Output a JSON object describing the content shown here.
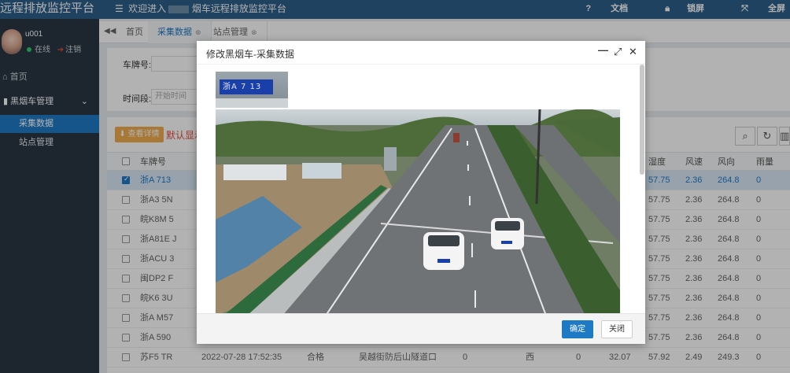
{
  "brand": "远程排放监控平台",
  "topbar": {
    "welcome": "欢迎进入",
    "welcome_rest": "烟车远程排放监控平台",
    "doc": "文档",
    "lock": "锁屏",
    "fullscreen": "全屏"
  },
  "user": {
    "name": "u001",
    "online": "在线",
    "logout": "注销"
  },
  "sidebar": {
    "home": "首页",
    "group": "黑烟车管理",
    "items": [
      {
        "label": "采集数据",
        "active": true
      },
      {
        "label": "站点管理",
        "active": false
      }
    ]
  },
  "tabs": [
    {
      "label": "首页",
      "active": false,
      "closable": false
    },
    {
      "label": "采集数据",
      "active": true,
      "closable": true
    },
    {
      "label": "站点管理",
      "active": false,
      "closable": true
    }
  ],
  "search": {
    "plate_label": "车牌号:",
    "time_label": "时间段:",
    "time_placeholder": "开始时间"
  },
  "toolbar": {
    "detail_button": "查看详情",
    "default_show": "默认显示"
  },
  "table": {
    "left_columns": [
      "车牌号"
    ],
    "right_columns": [
      "湿度",
      "风速",
      "风向",
      "雨量"
    ],
    "rows": [
      {
        "plate": "浙A 713",
        "humidity": "57.75",
        "wind_speed": "2.36",
        "wind_dir": "264.8",
        "rain": "0",
        "selected": true
      },
      {
        "plate": "浙A3 5N",
        "humidity": "57.75",
        "wind_speed": "2.36",
        "wind_dir": "264.8",
        "rain": "0",
        "selected": false
      },
      {
        "plate": "皖K8M 5",
        "humidity": "57.75",
        "wind_speed": "2.36",
        "wind_dir": "264.8",
        "rain": "0",
        "selected": false
      },
      {
        "plate": "浙A81E J",
        "humidity": "57.75",
        "wind_speed": "2.36",
        "wind_dir": "264.8",
        "rain": "0",
        "selected": false
      },
      {
        "plate": "浙ACU 3",
        "humidity": "57.75",
        "wind_speed": "2.36",
        "wind_dir": "264.8",
        "rain": "0",
        "selected": false
      },
      {
        "plate": "闽DP2 F",
        "humidity": "57.75",
        "wind_speed": "2.36",
        "wind_dir": "264.8",
        "rain": "0",
        "selected": false
      },
      {
        "plate": "皖K6 3U",
        "humidity": "57.75",
        "wind_speed": "2.36",
        "wind_dir": "264.8",
        "rain": "0",
        "selected": false
      },
      {
        "plate": "浙A M57",
        "humidity": "57.75",
        "wind_speed": "2.36",
        "wind_dir": "264.8",
        "rain": "0",
        "selected": false
      },
      {
        "plate": "浙A 590",
        "humidity": "57.75",
        "wind_speed": "2.36",
        "wind_dir": "264.8",
        "rain": "0",
        "selected": false
      }
    ],
    "last_row": {
      "plate": "苏F5 TR",
      "time": "2022-07-28 17:52:35",
      "result": "合格",
      "location": "吴越街防后山隧道口",
      "val1": "0",
      "direction": "西",
      "val2": "0",
      "temperature": "32.07",
      "humidity": "57.92",
      "wind_speed": "2.49",
      "wind_dir": "249.3",
      "rain": "0"
    }
  },
  "modal": {
    "title": "修改黑烟车-采集数据",
    "plate_text": "浙A 7 13",
    "ok": "确定",
    "close": "关闭"
  },
  "colors": {
    "topbar": "#2c5f8a",
    "sidebar": "#2a3542",
    "accent": "#1f7ac6",
    "warning": "#f0ad4e",
    "danger": "#e74c3c"
  }
}
